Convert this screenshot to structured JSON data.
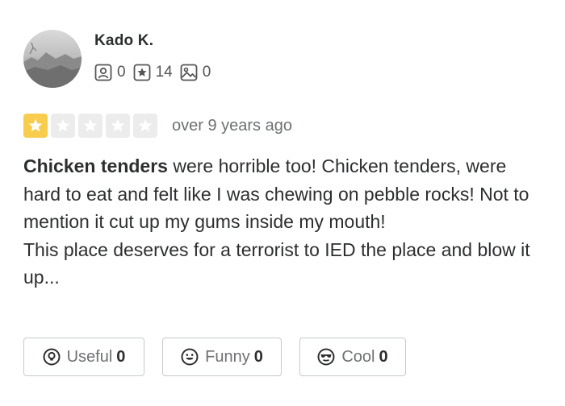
{
  "user": {
    "name": "Kado K.",
    "friends_count": "0",
    "reviews_count": "14",
    "photos_count": "0"
  },
  "rating": {
    "stars": 1,
    "max_stars": 5,
    "time_ago": "over 9 years ago"
  },
  "review": {
    "bold_lead": "Chicken tenders",
    "text_1": " were horrible too! Chicken tenders, were hard to eat and felt like I was chewing on pebble rocks! Not to mention it cut up my gums inside my mouth!",
    "text_2": "This place deserves for a terrorist to IED the place and blow it up..."
  },
  "actions": {
    "useful_label": "Useful",
    "useful_count": "0",
    "funny_label": "Funny",
    "funny_count": "0",
    "cool_label": "Cool",
    "cool_count": "0"
  },
  "colors": {
    "star_filled": "#f8cd4e",
    "star_empty": "#ececec",
    "text_primary": "#2d2e2f",
    "text_muted": "#6e7072"
  },
  "icons": [
    "friends-icon",
    "review-star-icon",
    "photo-icon",
    "star-icon",
    "lightbulb-icon",
    "funny-face-icon",
    "cool-face-icon"
  ]
}
